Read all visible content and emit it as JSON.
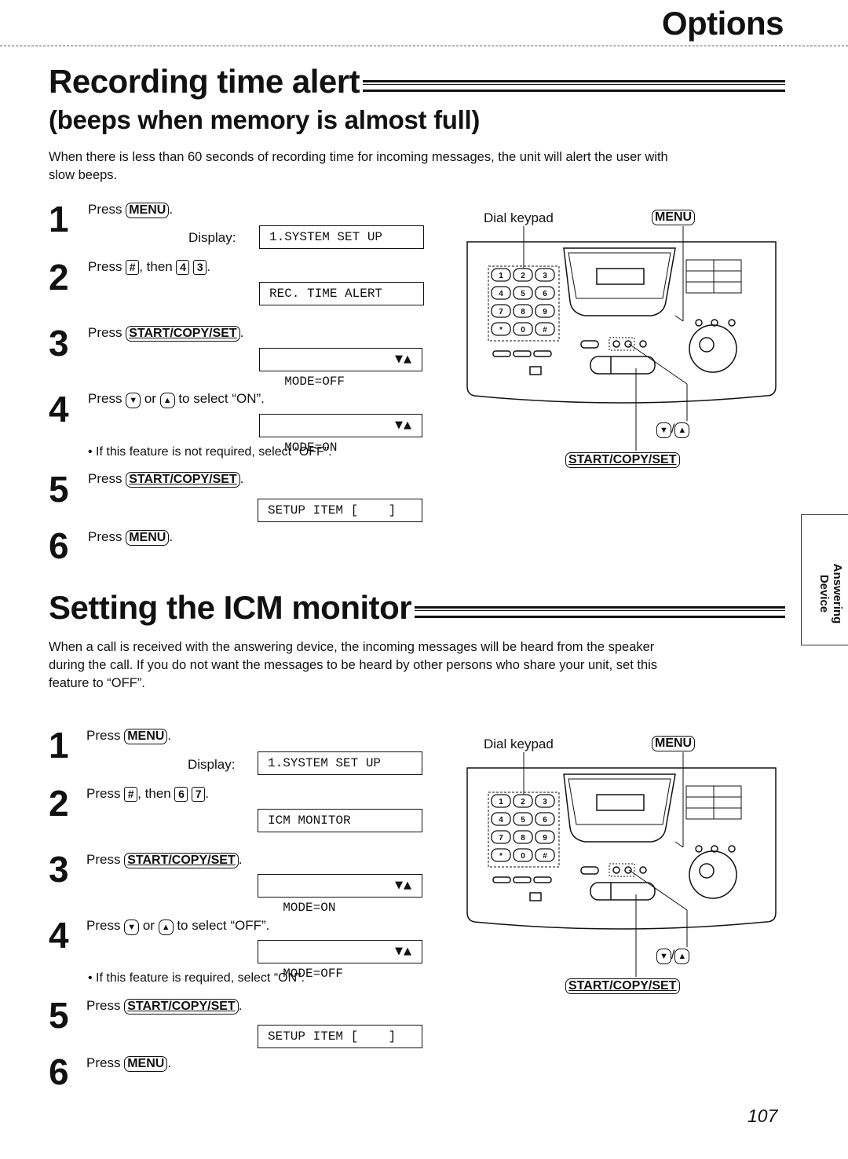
{
  "header": {
    "section": "Options"
  },
  "section1": {
    "title": "Recording time alert",
    "subtitle": "(beeps when memory is almost full)",
    "intro_line1": "When there is less than 60 seconds of recording time for incoming messages, the unit will alert the user with",
    "intro_line2": "slow beeps.",
    "steps": [
      {
        "num": "1",
        "press": "Press",
        "key": "MENU",
        "after": ".",
        "display_label": "Display:",
        "display": "1.SYSTEM SET UP"
      },
      {
        "num": "2",
        "press": "Press",
        "key1": "#",
        "then": ", then",
        "key2": "4",
        "key3": "3",
        "after": ".",
        "display": "REC. TIME ALERT"
      },
      {
        "num": "3",
        "press": "Press",
        "key": "START/COPY/SET",
        "after": ".",
        "display": "MODE=OFF",
        "display_arrows": "▼▲"
      },
      {
        "num": "4",
        "press": "Press",
        "key_down": "▼",
        "or": "or",
        "key_up": "▲",
        "tail": "to select “ON”.",
        "display": "MODE=ON",
        "display_arrows": "▼▲",
        "note": "• If this feature is not required, select “OFF”."
      },
      {
        "num": "5",
        "press": "Press",
        "key": "START/COPY/SET",
        "after": ".",
        "display": "SETUP ITEM [    ]"
      },
      {
        "num": "6",
        "press": "Press",
        "key": "MENU",
        "after": "."
      }
    ],
    "diagram": {
      "dial_keypad_label": "Dial keypad",
      "menu_label": "MENU",
      "nav_keys": [
        "▼",
        "/",
        "▲"
      ],
      "start_label": "START/COPY/SET",
      "keypad_keys": [
        "1",
        "2",
        "3",
        "4",
        "5",
        "6",
        "7",
        "8",
        "9",
        "*",
        "0",
        "#"
      ]
    }
  },
  "section2": {
    "title": "Setting the ICM monitor",
    "intro_line1": "When a call is received with the answering device, the incoming messages will be heard from the speaker",
    "intro_line2": "during the call. If you do not want the messages to be heard by other persons who share your unit, set this",
    "intro_line3": "feature to “OFF”.",
    "steps": [
      {
        "num": "1",
        "press": "Press",
        "key": "MENU",
        "after": ".",
        "display_label": "Display:",
        "display": "1.SYSTEM SET UP"
      },
      {
        "num": "2",
        "press": "Press",
        "key1": "#",
        "then": ", then",
        "key2": "6",
        "key3": "7",
        "after": ".",
        "display": "ICM MONITOR"
      },
      {
        "num": "3",
        "press": "Press",
        "key": "START/COPY/SET",
        "after": ".",
        "display": "MODE=ON",
        "display_arrows": "▼▲"
      },
      {
        "num": "4",
        "press": "Press",
        "key_down": "▼",
        "or": "or",
        "key_up": "▲",
        "tail": "to select “OFF”.",
        "display": "MODE=OFF",
        "display_arrows": "▼▲",
        "note": "• If this feature is required, select “ON”."
      },
      {
        "num": "5",
        "press": "Press",
        "key": "START/COPY/SET",
        "after": ".",
        "display": "SETUP ITEM [    ]"
      },
      {
        "num": "6",
        "press": "Press",
        "key": "MENU",
        "after": "."
      }
    ],
    "diagram": {
      "dial_keypad_label": "Dial keypad",
      "menu_label": "MENU",
      "nav_keys": [
        "▼",
        "/",
        "▲"
      ],
      "start_label": "START/COPY/SET",
      "keypad_keys": [
        "1",
        "2",
        "3",
        "4",
        "5",
        "6",
        "7",
        "8",
        "9",
        "*",
        "0",
        "#"
      ]
    }
  },
  "sidetab": {
    "line1": "Answering",
    "line2": "Device"
  },
  "footer": {
    "page_number": "107"
  }
}
